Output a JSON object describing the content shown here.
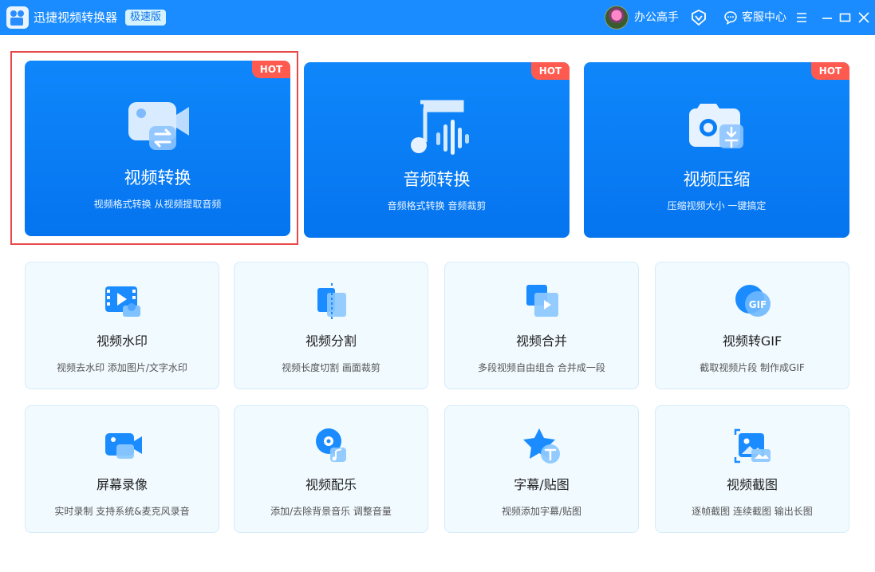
{
  "header": {
    "app_title": "迅捷视频转换器",
    "edition": "极速版",
    "user_name": "办公高手",
    "service_label": "客服中心"
  },
  "hero_cards": [
    {
      "title": "视频转换",
      "desc": "视频格式转换 从视频提取音频",
      "badge": "HOT",
      "icon": "video-convert-icon"
    },
    {
      "title": "音频转换",
      "desc": "音频格式转换 音频裁剪",
      "badge": "HOT",
      "icon": "audio-convert-icon"
    },
    {
      "title": "视频压缩",
      "desc": "压缩视频大小 一键搞定",
      "badge": "HOT",
      "icon": "video-compress-icon"
    }
  ],
  "tools": [
    {
      "title": "视频水印",
      "desc": "视频去水印 添加图片/文字水印",
      "icon": "watermark-icon"
    },
    {
      "title": "视频分割",
      "desc": "视频长度切割 画面裁剪",
      "icon": "split-icon"
    },
    {
      "title": "视频合并",
      "desc": "多段视频自由组合 合并成一段",
      "icon": "merge-icon"
    },
    {
      "title": "视频转GIF",
      "desc": "截取视频片段 制作成GIF",
      "icon": "gif-icon",
      "icon_text": "GIF"
    },
    {
      "title": "屏幕录像",
      "desc": "实时录制 支持系统&麦克风录音",
      "icon": "screen-record-icon"
    },
    {
      "title": "视频配乐",
      "desc": "添加/去除背景音乐 调整音量",
      "icon": "music-icon"
    },
    {
      "title": "字幕/贴图",
      "desc": "视频添加字幕/贴图",
      "icon": "subtitle-icon"
    },
    {
      "title": "视频截图",
      "desc": "逐帧截图 连续截图 输出长图",
      "icon": "screenshot-icon"
    }
  ],
  "colors": {
    "titlebar": "#1a8cff",
    "hero": "#0a7ef6",
    "hot": "#ff5a4f",
    "tool_bg": "#f1faff",
    "selection": "#e94848"
  }
}
